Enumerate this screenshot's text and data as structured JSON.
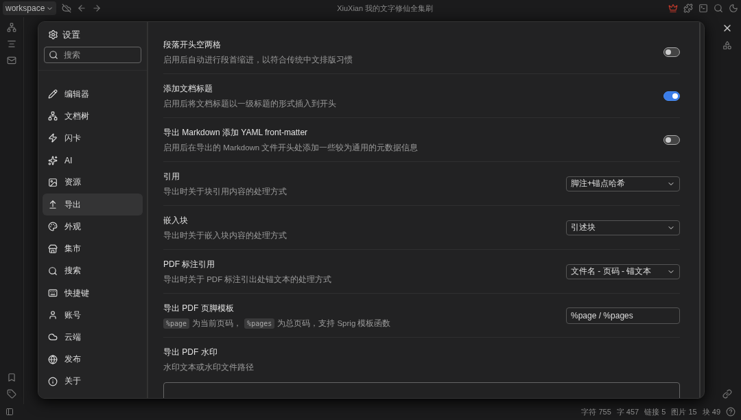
{
  "topbar": {
    "workspace": "workspace",
    "title": "XiuXian 我的文字修仙全集刷"
  },
  "settings": {
    "title": "设置",
    "search_placeholder": "搜索",
    "nav": [
      {
        "label": "编辑器",
        "selected": false
      },
      {
        "label": "文档树",
        "selected": false
      },
      {
        "label": "闪卡",
        "selected": false
      },
      {
        "label": "AI",
        "selected": false
      },
      {
        "label": "资源",
        "selected": false
      },
      {
        "label": "导出",
        "selected": true
      },
      {
        "label": "外观",
        "selected": false
      },
      {
        "label": "集市",
        "selected": false
      },
      {
        "label": "搜索",
        "selected": false
      },
      {
        "label": "快捷键",
        "selected": false
      },
      {
        "label": "账号",
        "selected": false
      },
      {
        "label": "云端",
        "selected": false
      },
      {
        "label": "发布",
        "selected": false
      },
      {
        "label": "关于",
        "selected": false
      }
    ],
    "rows": [
      {
        "kind": "switch",
        "title": "段落开头空两格",
        "description": "启用后自动进行段首缩进，以符合传统中文排版习惯",
        "on": false
      },
      {
        "kind": "switch",
        "title": "添加文档标题",
        "description": "启用后将文档标题以一级标题的形式插入到开头",
        "on": true
      },
      {
        "kind": "switch",
        "title": "导出 Markdown 添加 YAML front-matter",
        "description": "启用后在导出的 Markdown 文件开头处添加一些较为通用的元数据信息",
        "on": false
      },
      {
        "kind": "select",
        "title": "引用",
        "description": "导出时关于块引用内容的处理方式",
        "value": "脚注+锚点哈希"
      },
      {
        "kind": "select",
        "title": "嵌入块",
        "description": "导出时关于嵌入块内容的处理方式",
        "value": "引述块"
      },
      {
        "kind": "select",
        "title": "PDF 标注引用",
        "description": "导出时关于 PDF 标注引出处锚文本的处理方式",
        "value": "文件名 - 页码 - 锚文本"
      },
      {
        "kind": "input",
        "title": "导出 PDF 页脚模板",
        "description_parts": [
          {
            "kind": "code",
            "text": "%page"
          },
          {
            "kind": "text",
            "text": "为当前页码，"
          },
          {
            "kind": "code",
            "text": "%pages"
          },
          {
            "kind": "text",
            "text": "为总页码，支持 Sprig 模板函数"
          }
        ],
        "value": "%page / %pages"
      },
      {
        "kind": "textarea",
        "title": "导出 PDF 水印",
        "description": "水印文本或水印文件路径"
      }
    ]
  },
  "status": [
    "字符 755",
    "字 457",
    "链接 5",
    "图片 15",
    "块 49"
  ]
}
